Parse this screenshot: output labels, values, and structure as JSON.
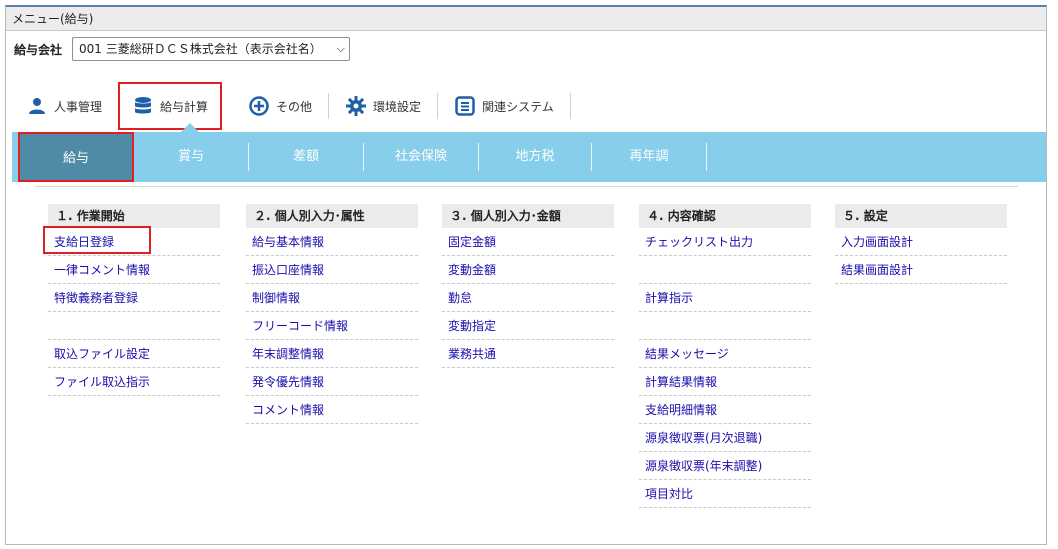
{
  "titlebar": {
    "title": "メニュー(給与)"
  },
  "company": {
    "label": "給与会社",
    "value": "001 三菱総研ＤＣＳ株式会社（表示会社名）"
  },
  "topnav": [
    {
      "label": "人事管理",
      "icon": "person-icon"
    },
    {
      "label": "給与計算",
      "icon": "database-icon"
    },
    {
      "label": "その他",
      "icon": "plus-circle-icon"
    },
    {
      "label": "環境設定",
      "icon": "gear-icon"
    },
    {
      "label": "関連システム",
      "icon": "list-icon"
    }
  ],
  "tabs": [
    "給与",
    "賞与",
    "差額",
    "社会保険",
    "地方税",
    "再年調"
  ],
  "columns": [
    {
      "heading": "１. 作業開始",
      "links": [
        "支給日登録",
        "一律コメント情報",
        "特徴義務者登録",
        "",
        "取込ファイル設定",
        "ファイル取込指示"
      ]
    },
    {
      "heading": "２. 個人別入力･属性",
      "links": [
        "給与基本情報",
        "振込口座情報",
        "制御情報",
        "フリーコード情報",
        "年末調整情報",
        "発令優先情報",
        "コメント情報"
      ]
    },
    {
      "heading": "３. 個人別入力･金額",
      "links": [
        "固定金額",
        "変動金額",
        "勤怠",
        "変動指定",
        "業務共通"
      ]
    },
    {
      "heading": "４. 内容確認",
      "links": [
        "チェックリスト出力",
        "",
        "計算指示",
        "",
        "結果メッセージ",
        "計算結果情報",
        "支給明細情報",
        "源泉徴収票(月次退職)",
        "源泉徴収票(年末調整)",
        "項目対比"
      ]
    },
    {
      "heading": "５. 設定",
      "links": [
        "入力画面設計",
        "結果画面設計"
      ]
    }
  ],
  "colors": {
    "tabbar": "#87ceeb",
    "active_tab": "#4f8aa7",
    "highlight": "#e02020",
    "link": "#1a0dab"
  }
}
